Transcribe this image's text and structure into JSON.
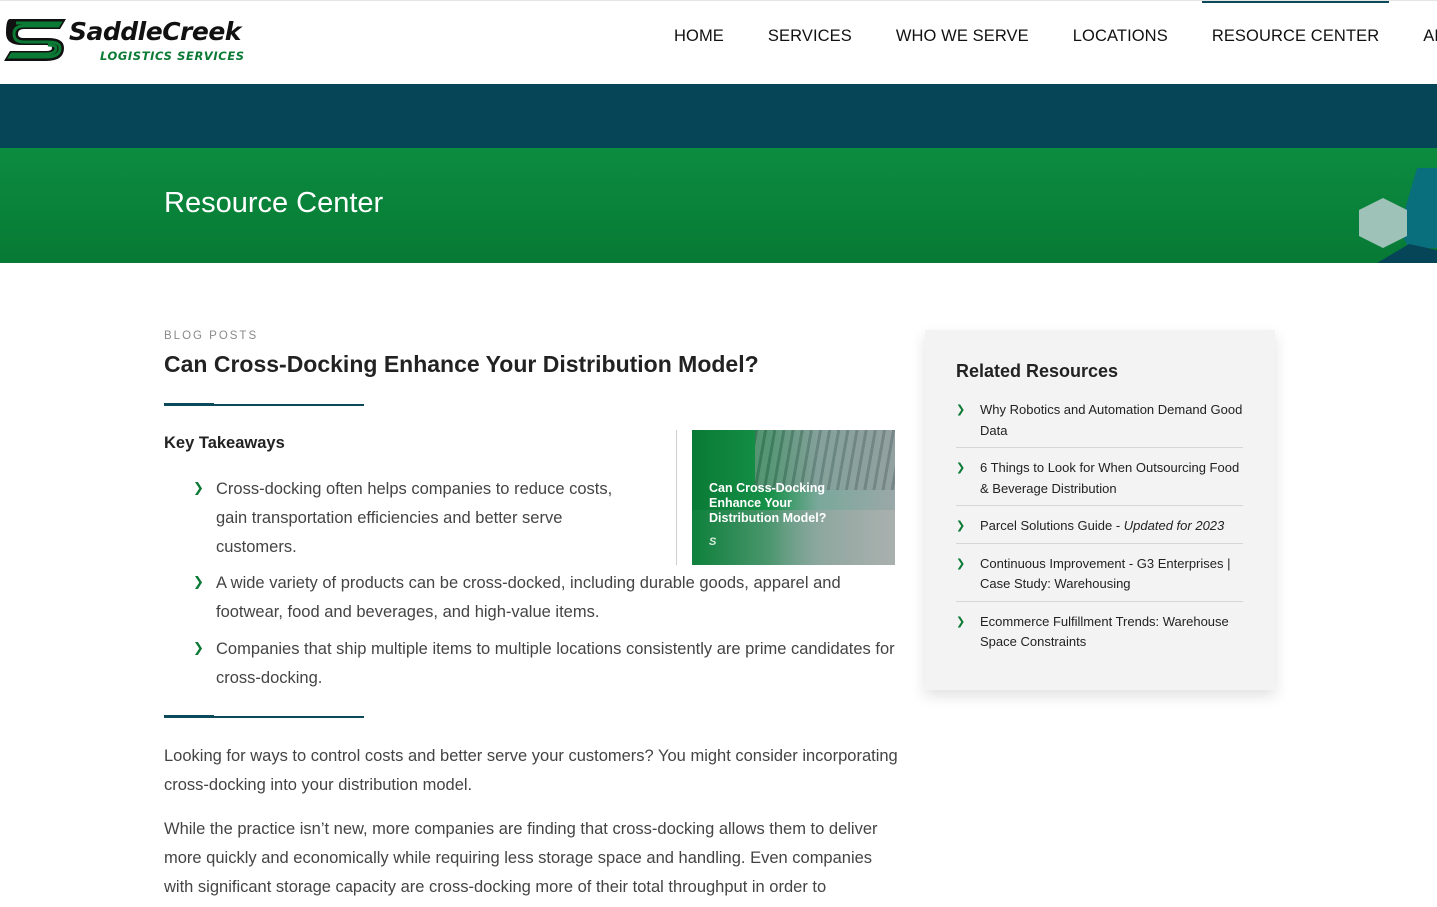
{
  "brand": {
    "name": "SaddleCreek",
    "tagline": "LOGISTICS SERVICES",
    "green": "#0b7a35",
    "teal": "#064557"
  },
  "nav": {
    "items": [
      {
        "label": "HOME"
      },
      {
        "label": "SERVICES"
      },
      {
        "label": "WHO WE SERVE"
      },
      {
        "label": "LOCATIONS"
      },
      {
        "label": "RESOURCE CENTER",
        "active": true
      },
      {
        "label": "ABOUT"
      }
    ]
  },
  "hero": {
    "title": "Resource Center"
  },
  "article": {
    "category": "BLOG POSTS",
    "title": "Can Cross-Docking Enhance Your Distribution Model?",
    "takeaways_heading": "Key Takeaways",
    "takeaways": [
      "Cross-docking often helps companies to reduce costs, gain transportation efficiencies and better serve customers.",
      "A wide variety of products can be cross-docked, including durable goods, apparel and footwear, food and beverages, and high-value items.",
      "Companies that ship multiple items to multiple locations consistently are prime candidates for cross-docking."
    ],
    "thumbnail_text": "Can Cross-Docking Enhance Your Distribution Model?",
    "paragraphs": [
      "Looking for ways to control costs and better serve your customers? You might consider incorporating cross-docking into your distribution model.",
      "While the practice isn’t new, more companies are finding that cross-docking allows them to deliver more quickly and economically while requiring less storage space and handling. Even companies with significant storage capacity are cross-docking more of their total throughput in order to"
    ]
  },
  "sidebar": {
    "title": "Related Resources",
    "items": [
      {
        "label": "Why Robotics and Automation Demand Good Data",
        "suffix": ""
      },
      {
        "label": "6 Things to Look for When Outsourcing Food & Beverage Distribution",
        "suffix": ""
      },
      {
        "label": "Parcel Solutions Guide - ",
        "suffix": "Updated for 2023"
      },
      {
        "label": "Continuous Improvement - G3 Enterprises | Case Study: Warehousing",
        "suffix": ""
      },
      {
        "label": "Ecommerce Fulfillment Trends: Warehouse Space Constraints",
        "suffix": ""
      }
    ]
  }
}
